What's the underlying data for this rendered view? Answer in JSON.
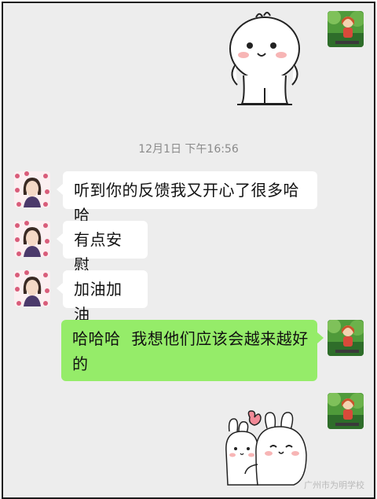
{
  "conversation": {
    "timestamp": "12月1日 下午16:56",
    "messages": [
      {
        "sender": "other",
        "text": "听到你的反馈我又开心了很多哈哈"
      },
      {
        "sender": "other",
        "text": "有点安慰"
      },
      {
        "sender": "other",
        "text": "加油加油"
      },
      {
        "sender": "self",
        "line1": "哈哈哈  我想他们应该会越来越好",
        "line2": "的"
      }
    ],
    "stickers": [
      {
        "sender": "self",
        "icon": "smiling-bun-sticker-icon"
      },
      {
        "sender": "self",
        "icon": "hugging-bunnies-sticker-icon"
      }
    ]
  },
  "watermark": "广州市为明学校",
  "colors": {
    "chat_background": "#ededed",
    "self_bubble": "#95ec69",
    "other_bubble": "#ffffff",
    "timestamp_text": "#8a8a8a"
  }
}
